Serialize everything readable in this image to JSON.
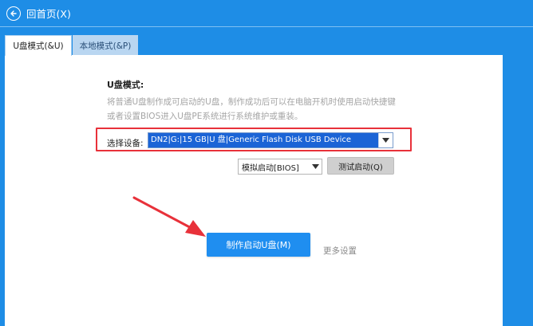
{
  "header": {
    "back_label": "回首页(X)"
  },
  "tabs": [
    {
      "label": "U盘模式(&U)",
      "active": true
    },
    {
      "label": "本地模式(&P)",
      "active": false
    }
  ],
  "usb_mode": {
    "title": "U盘模式:",
    "description": "将普通U盘制作成可启动的U盘，制作成功后可以在电脑开机时使用启动快捷键或者设置BIOS进入U盘PE系统进行系统维护或重装。",
    "device_label": "选择设备:",
    "device_value": "DN2|G:|15 GB|U 盘|Generic Flash Disk USB Device",
    "boot_mode_value": "模拟启动[BIOS]",
    "test_boot_label": "测试启动(Q)",
    "make_button_label": "制作启动U盘(M)",
    "more_settings_label": "更多设置"
  },
  "colors": {
    "background": "#1e8de6",
    "highlight_border": "#e8313a",
    "primary_button": "#1f8ef0",
    "selected_value_bg": "#1b64d6"
  }
}
